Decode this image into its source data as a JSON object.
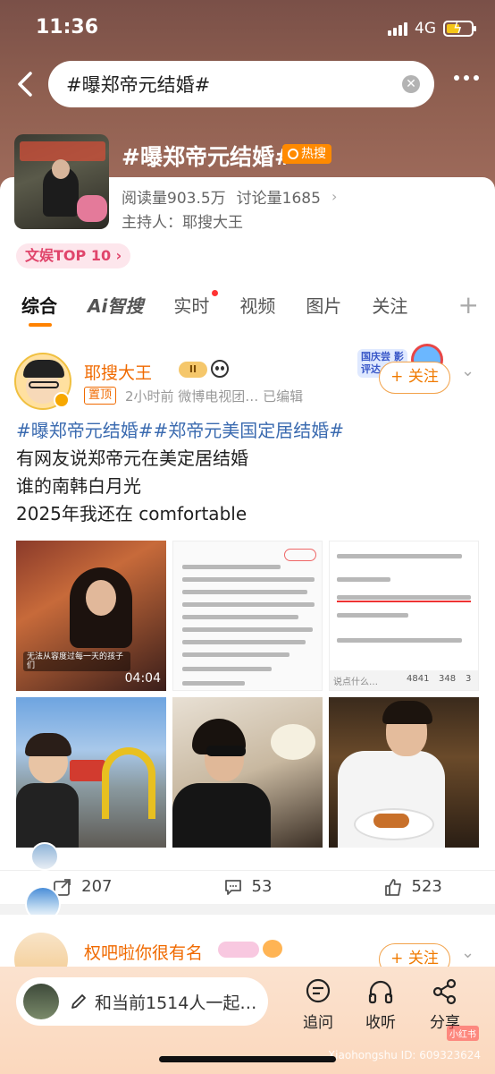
{
  "status_bar": {
    "time": "11:36",
    "network": "4G"
  },
  "search": {
    "query": "#曝郑帝元结婚#"
  },
  "topic": {
    "title": "#曝郑帝元结婚#",
    "hot_badge": "热搜",
    "reads_label": "阅读量903.5万",
    "discuss_label": "讨论量1685",
    "host_label": "主持人：耶搜大王",
    "top10_label": "文娱TOP 10"
  },
  "tabs": [
    {
      "label": "综合",
      "active": true
    },
    {
      "label": "Ai智搜",
      "active": false
    },
    {
      "label": "实时",
      "active": false
    },
    {
      "label": "视频",
      "active": false
    },
    {
      "label": "图片",
      "active": false
    },
    {
      "label": "关注",
      "active": false
    }
  ],
  "post": {
    "author": "耶搜大王",
    "vip_level": "II",
    "pinned": "置顶",
    "meta": "2小时前  微博电视团…  已编辑",
    "festival_badge": "国庆尝 影评达",
    "follow": "+ 关注",
    "hashtags": "#曝郑帝元结婚##郑帝元美国定居结婚#",
    "lines": [
      "有网友说郑帝元在美定居结婚",
      "谁的南韩白月光",
      "2025年我还在 comfortable"
    ],
    "video_duration": "04:04",
    "video_caption": "无法从容度过每一天的孩子们",
    "screenshot_text": "说点什么…",
    "screenshot_likes": "4841",
    "screenshot_stars": "348",
    "screenshot_comments": "3",
    "actions": {
      "repost": "207",
      "comment": "53",
      "like": "523"
    }
  },
  "post2": {
    "author": "权吧啦你很有名",
    "follow": "+ 关注"
  },
  "bottom_bar": {
    "comment_placeholder": "和当前1514人一起…",
    "tool_ask": "追问",
    "tool_listen": "收听",
    "tool_share": "分享"
  },
  "watermark": "Xiaohongshu ID: 609323624",
  "watermark_badge": "小红书",
  "colors": {
    "accent": "#ff8200",
    "link": "#3b6bb0",
    "author": "#f06a00"
  }
}
